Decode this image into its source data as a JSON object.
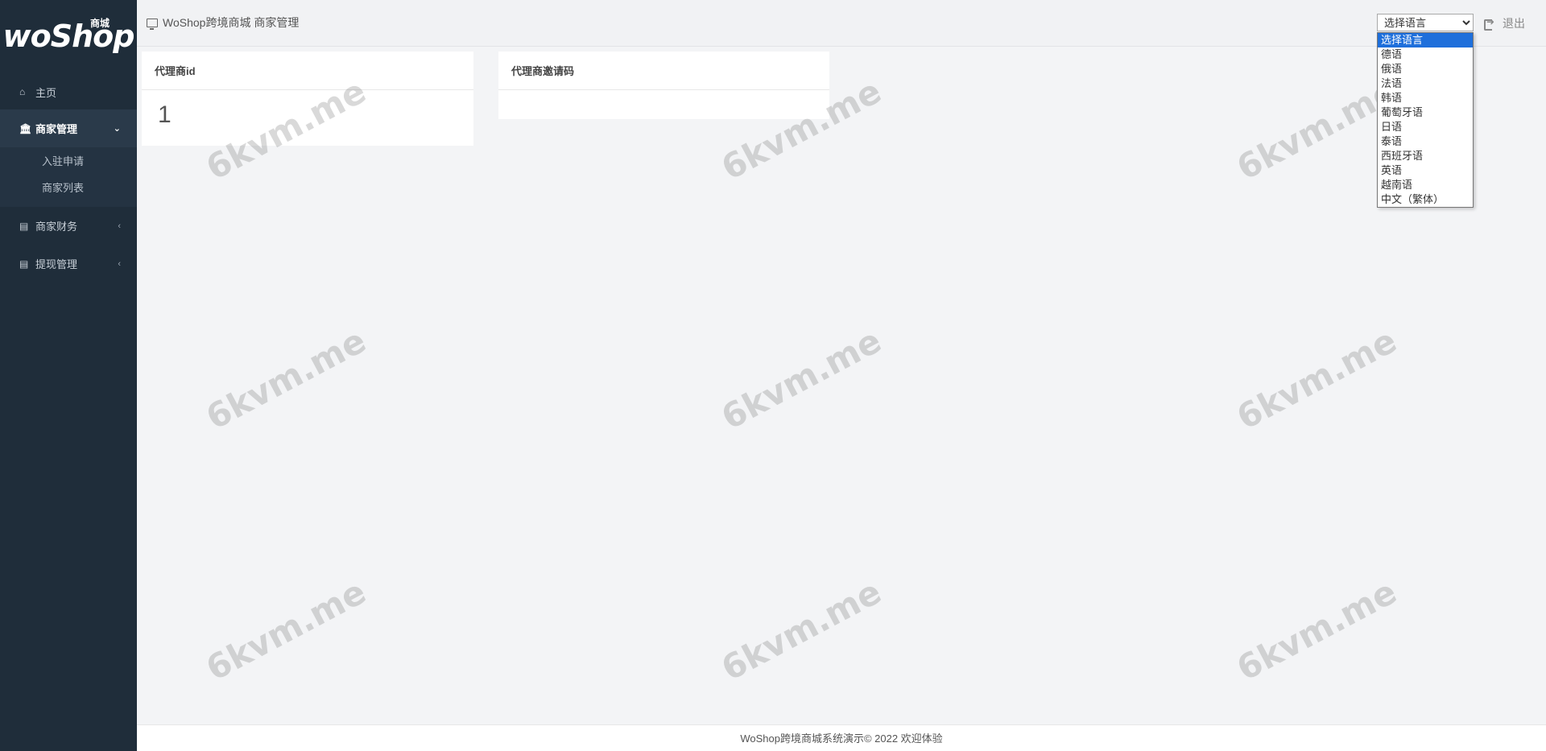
{
  "logo": {
    "text": "woShop",
    "sub": "商城"
  },
  "sidebar": {
    "items": [
      {
        "label": "主页",
        "icon": "home-icon"
      },
      {
        "label": "商家管理",
        "icon": "bank-icon",
        "expanded": true,
        "children": [
          {
            "label": "入驻申请"
          },
          {
            "label": "商家列表"
          }
        ]
      },
      {
        "label": "商家财务",
        "icon": "card-icon"
      },
      {
        "label": "提现管理",
        "icon": "list-icon"
      }
    ]
  },
  "header": {
    "breadcrumb": "WoShop跨境商城 商家管理",
    "language_select": {
      "selected": "选择语言",
      "options": [
        "选择语言",
        "德语",
        "俄语",
        "法语",
        "韩语",
        "葡萄牙语",
        "日语",
        "泰语",
        "西班牙语",
        "英语",
        "越南语",
        "中文（繁体）"
      ]
    },
    "logout_label": "退出"
  },
  "cards": [
    {
      "title": "代理商id",
      "value": "1"
    },
    {
      "title": "代理商邀请码",
      "value": ""
    }
  ],
  "footer": {
    "text": "WoShop跨境商城系统演示© 2022 欢迎体验"
  },
  "watermark": "6kvm.me",
  "colors": {
    "sidebar_bg": "#1f2d3a",
    "selected_option": "#1e6fdb"
  }
}
